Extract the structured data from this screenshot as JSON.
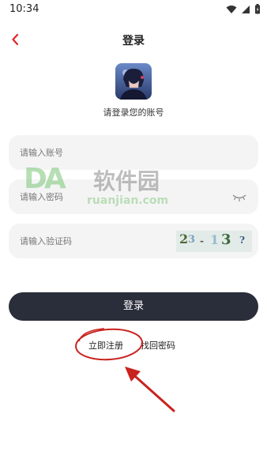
{
  "status_bar": {
    "time": "10:34"
  },
  "header": {
    "title": "登录"
  },
  "subtitle": "请登录您的账号",
  "form": {
    "account_placeholder": "请输入账号",
    "password_placeholder": "请输入密码",
    "captcha_placeholder": "请输入验证码",
    "captcha_text": [
      "2",
      "3",
      "-",
      "1",
      "3",
      "?"
    ]
  },
  "buttons": {
    "login": "登录"
  },
  "links": {
    "register": "立即注册",
    "forgot": "找回密码"
  },
  "watermark": {
    "logo": "DA",
    "cn": "软件园",
    "en": "ruanjian.com"
  },
  "colors": {
    "accent": "#e0262a",
    "button": "#2a2e3a",
    "field_bg": "#f4f4f5",
    "annotation": "#c8231f"
  }
}
